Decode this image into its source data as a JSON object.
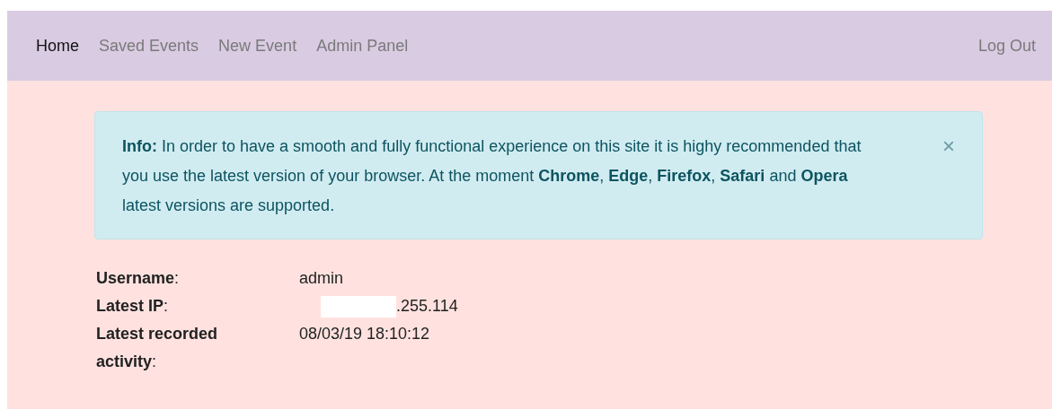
{
  "navbar": {
    "items": [
      {
        "label": "Home",
        "selected": true
      },
      {
        "label": "Saved Events",
        "selected": false
      },
      {
        "label": "New Event",
        "selected": false
      },
      {
        "label": "Admin Panel",
        "selected": false
      }
    ],
    "logout": "Log Out"
  },
  "alert": {
    "text": "**Info:** In order to have a smooth and fully functional experience on this site it is highy recommended that you use the latest version of your browser. At the moment **Chrome**, **Edge**, **Firefox**, **Safari** and **Opera** latest versions are supported.",
    "close": "×"
  },
  "details": [
    {
      "label": "**Username**:",
      "value": "admin",
      "redacted": false
    },
    {
      "label": "**Latest IP**:",
      "value": ".255.114",
      "redacted": true
    },
    {
      "label": "**Latest recorded activity**:",
      "value": "08/03/19 18:10:12",
      "redacted": false
    }
  ]
}
